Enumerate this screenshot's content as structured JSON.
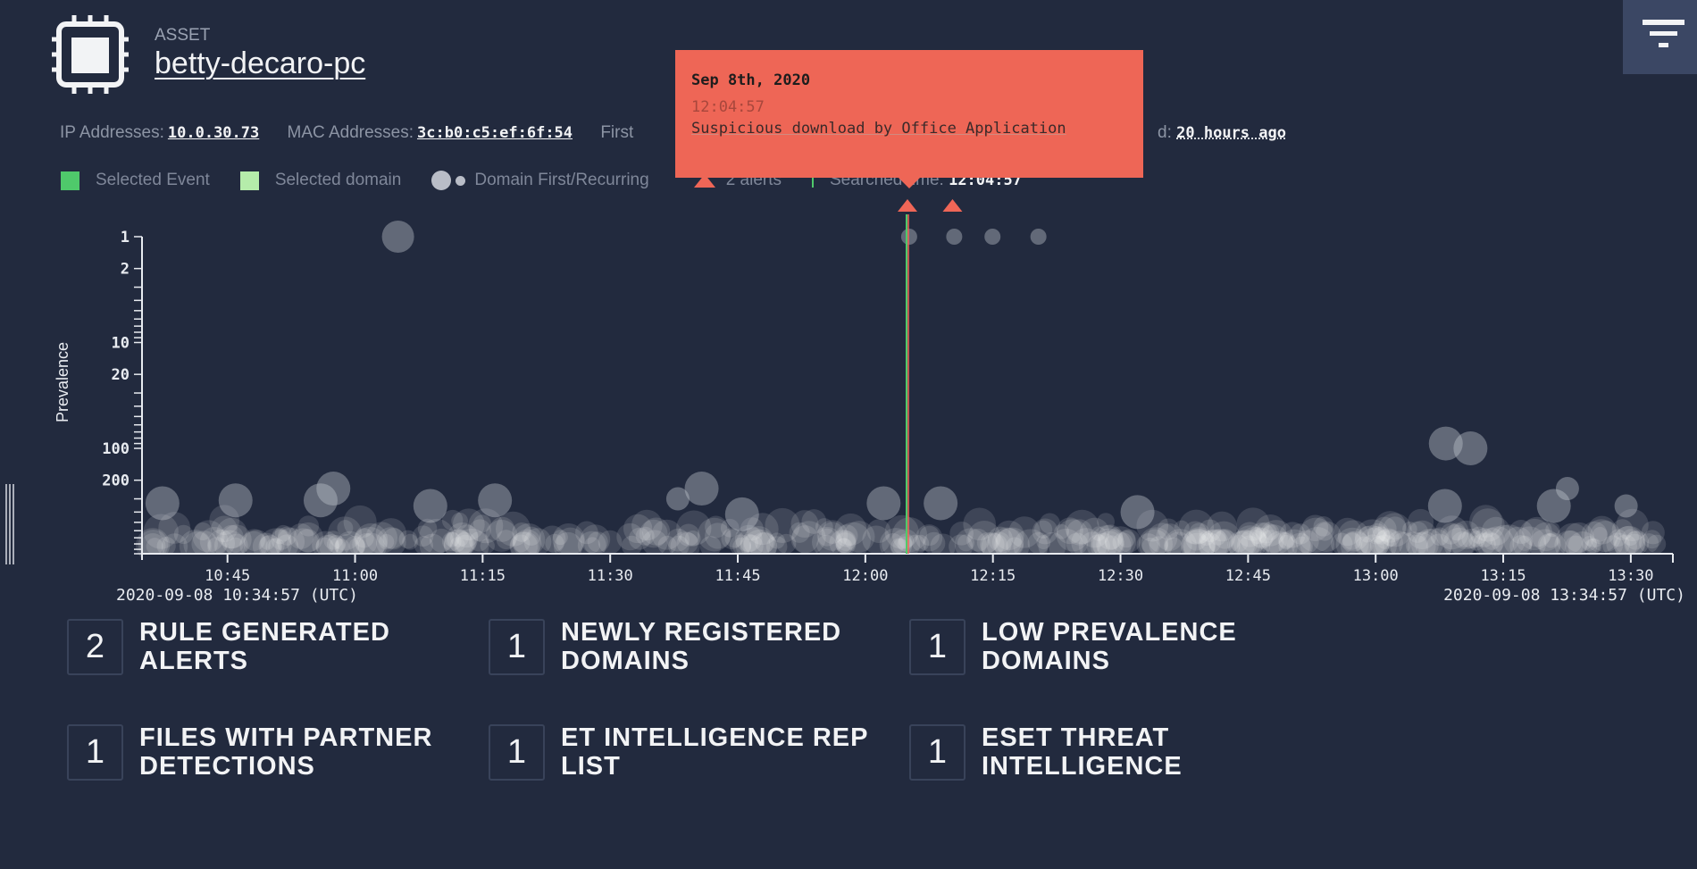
{
  "asset": {
    "label": "ASSET",
    "name": "betty-decaro-pc",
    "icon": "cpu-chip-icon"
  },
  "info": {
    "ip_label": "IP Addresses:",
    "ip_value": "10.0.30.73",
    "mac_label": "MAC Addresses:",
    "mac_value": "3c:b0:c5:ef:6f:54",
    "first_label": "First",
    "last_label_tail": "d:",
    "last_value": "20 hours ago"
  },
  "legend": {
    "selected_event": "Selected Event",
    "selected_event_color": "#4fc96b",
    "selected_domain": "Selected domain",
    "selected_domain_color": "#b5ecaa",
    "domain_first_recurring": "Domain First/Recurring",
    "alerts": "2 alerts",
    "alert_color": "#ef6657",
    "searched_time_label": "Searched time:",
    "searched_time_value": "12:04:57"
  },
  "tooltip": {
    "date": "Sep 8th, 2020",
    "time": "12:04:57",
    "message": "Suspicious download by Office Application",
    "color": "#ee6656"
  },
  "filter_button": {
    "icon": "filter-icon"
  },
  "chart_data": {
    "type": "scatter",
    "ylabel": "Prevalence",
    "y_scale": "log",
    "y_reversed": true,
    "ylim": [
      1,
      1000
    ],
    "y_ticks": [
      "1",
      "2",
      "10",
      "20",
      "100",
      "200"
    ],
    "x_start": "10:34:57",
    "x_end": "13:34:57",
    "x_ticks": [
      "10:45",
      "11:00",
      "11:15",
      "11:30",
      "11:45",
      "12:00",
      "12:15",
      "12:30",
      "12:45",
      "13:00",
      "13:15",
      "13:30"
    ],
    "x_start_label": "2020-09-08 10:34:57 (UTC)",
    "x_end_label": "2020-09-08 13:34:57 (UTC)",
    "selected_time": "12:04:57",
    "alerts": [
      "12:04:57",
      "12:10:15"
    ],
    "points": [
      {
        "time": "11:05:03",
        "prevalence": 1,
        "kind": "first"
      },
      {
        "time": "12:05:09",
        "prevalence": 1,
        "kind": "recurring"
      },
      {
        "time": "12:10:27",
        "prevalence": 1,
        "kind": "recurring"
      },
      {
        "time": "12:14:57",
        "prevalence": 1,
        "kind": "recurring"
      },
      {
        "time": "12:20:21",
        "prevalence": 1,
        "kind": "recurring"
      },
      {
        "time": "13:08:15",
        "prevalence": 90,
        "kind": "first"
      },
      {
        "time": "13:11:09",
        "prevalence": 100,
        "kind": "first"
      },
      {
        "time": "11:40:45",
        "prevalence": 240,
        "kind": "first"
      },
      {
        "time": "10:57:27",
        "prevalence": 240,
        "kind": "first"
      },
      {
        "time": "11:37:57",
        "prevalence": 300,
        "kind": "recurring"
      },
      {
        "time": "13:22:33",
        "prevalence": 240,
        "kind": "recurring"
      },
      {
        "time": "13:29:27",
        "prevalence": 350,
        "kind": "recurring"
      },
      {
        "time": "12:02:09",
        "prevalence": 330,
        "kind": "first"
      },
      {
        "time": "12:08:51",
        "prevalence": 330,
        "kind": "first"
      },
      {
        "time": "11:16:27",
        "prevalence": 310,
        "kind": "first"
      },
      {
        "time": "10:45:57",
        "prevalence": 310,
        "kind": "first"
      },
      {
        "time": "10:55:57",
        "prevalence": 310,
        "kind": "first"
      },
      {
        "time": "11:08:51",
        "prevalence": 350,
        "kind": "first"
      },
      {
        "time": "10:37:21",
        "prevalence": 330,
        "kind": "first"
      },
      {
        "time": "13:20:57",
        "prevalence": 350,
        "kind": "first"
      },
      {
        "time": "13:08:09",
        "prevalence": 350,
        "kind": "first"
      },
      {
        "time": "12:32:00",
        "prevalence": 400,
        "kind": "first"
      },
      {
        "time": "11:45:30",
        "prevalence": 420,
        "kind": "first"
      }
    ]
  },
  "cards": [
    {
      "count": "2",
      "label": "RULE GENERATED ALERTS"
    },
    {
      "count": "1",
      "label": "NEWLY REGISTERED DOMAINS"
    },
    {
      "count": "1",
      "label": "LOW PREVALENCE DOMAINS"
    },
    {
      "count": "1",
      "label": "FILES WITH PARTNER DETECTIONS"
    },
    {
      "count": "1",
      "label": "ET INTELLIGENCE REP LIST"
    },
    {
      "count": "1",
      "label": "ESET THREAT INTELLIGENCE"
    }
  ]
}
